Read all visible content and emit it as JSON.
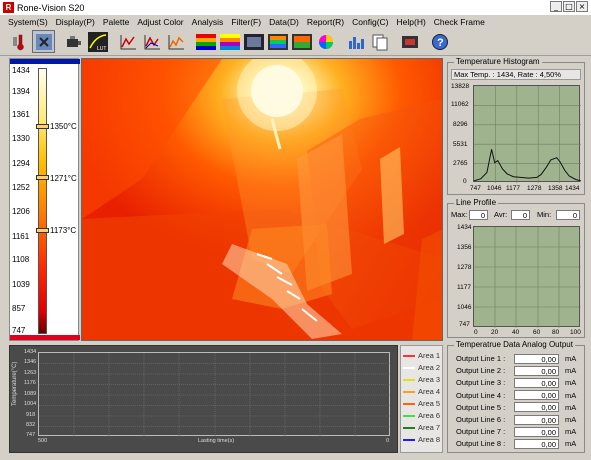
{
  "window": {
    "title": "Rone-Vision S20",
    "app_icon": "R",
    "buttons": [
      "_",
      "□",
      "×"
    ]
  },
  "menu": [
    "System(S)",
    "Display(P)",
    "Palette",
    "Adjust Color",
    "Analysis",
    "Filter(F)",
    "Data(D)",
    "Report(R)",
    "Config(C)",
    "Help(H)",
    "Check Frame"
  ],
  "toolbar": {
    "icons": [
      "thermometer-icon",
      "spot-measure-icon",
      "camera-icon",
      "lut-icon",
      "chart-line-icon-1",
      "chart-line-icon-2",
      "chart-line-icon-3",
      "palette-rainbow-icon",
      "palette-iron-icon",
      "image-gray-icon",
      "image-color-icon",
      "image-filter-icon",
      "color-wheel-icon",
      "bar-chart-icon",
      "copy-icon",
      "snapshot-icon",
      "help-icon"
    ],
    "lut_label": "LUT"
  },
  "scale": {
    "ticks": [
      "1434",
      "1394",
      "1361",
      "1330",
      "1294",
      "1252",
      "1206",
      "1161",
      "1108",
      "1039",
      "857",
      "747"
    ],
    "markers": [
      "1350°C",
      "1271°C",
      "1173°C"
    ],
    "colors": {
      "top": "#0018a8",
      "bottom": "#e00020"
    }
  },
  "histogram": {
    "title": "Temperature Histogram",
    "info": "Max Temp. : 1434,   Rate : 4,50%",
    "y_ticks": [
      "13828",
      "11062",
      "8296",
      "5531",
      "2765",
      "0"
    ],
    "x_ticks": [
      "747",
      "1046",
      "1177",
      "1278",
      "1358",
      "1434"
    ]
  },
  "line_profile": {
    "title": "Line Profile",
    "max_label": "Max:",
    "max_value": "0",
    "avr_label": "Avr:",
    "avr_value": "0",
    "min_label": "Min:",
    "min_value": "0",
    "y_ticks": [
      "1434",
      "1356",
      "1278",
      "1177",
      "1046",
      "747"
    ],
    "x_ticks": [
      "0",
      "20",
      "40",
      "60",
      "80",
      "100"
    ]
  },
  "trend": {
    "ylabel": "Temperature(°C)",
    "xlabel": "Lasting time(s)",
    "x_start": "500",
    "x_end": "0",
    "y_ticks": [
      "1434",
      "1346",
      "1263",
      "1176",
      "1089",
      "1004",
      "918",
      "832",
      "747"
    ]
  },
  "legend": {
    "items": [
      {
        "label": "Area 1",
        "color": "#ff3030"
      },
      {
        "label": "Area 2",
        "color": "#ffffff"
      },
      {
        "label": "Area 3",
        "color": "#e0e020"
      },
      {
        "label": "Area 4",
        "color": "#ffa020"
      },
      {
        "label": "Area 5",
        "color": "#ff6020"
      },
      {
        "label": "Area 6",
        "color": "#40e040"
      },
      {
        "label": "Area 7",
        "color": "#208020"
      },
      {
        "label": "Area 8",
        "color": "#2020ff"
      }
    ]
  },
  "analog": {
    "title": "Temperatrue Data Analog Output",
    "rows": [
      {
        "label": "Output Line 1 :",
        "value": "0,00",
        "unit": "mA"
      },
      {
        "label": "Output Line 2 :",
        "value": "0,00",
        "unit": "mA"
      },
      {
        "label": "Output Line 3 :",
        "value": "0,00",
        "unit": "mA"
      },
      {
        "label": "Output Line 4 :",
        "value": "0,00",
        "unit": "mA"
      },
      {
        "label": "Output Line 5 :",
        "value": "0,00",
        "unit": "mA"
      },
      {
        "label": "Output Line 6 :",
        "value": "0,00",
        "unit": "mA"
      },
      {
        "label": "Output Line 7 :",
        "value": "0,00",
        "unit": "mA"
      },
      {
        "label": "Output Line 8 :",
        "value": "0,00",
        "unit": "mA"
      }
    ]
  },
  "chart_data": {
    "type": "line",
    "title": "Temperature Histogram",
    "xlabel": "",
    "ylabel": "",
    "xlim": [
      747,
      1434
    ],
    "ylim": [
      0,
      13828
    ],
    "series": [
      {
        "x": [
          747,
          790,
          830,
          860,
          880,
          900,
          930,
          960,
          1000,
          1046,
          1100,
          1150,
          1177,
          1210,
          1240,
          1278,
          1300,
          1330,
          1358,
          1400,
          1434
        ],
        "values": [
          300,
          600,
          1500,
          4800,
          2900,
          3200,
          2000,
          1300,
          900,
          800,
          700,
          800,
          1200,
          2200,
          3300,
          3600,
          3000,
          1800,
          1000,
          500,
          300
        ]
      }
    ],
    "grid": true
  }
}
